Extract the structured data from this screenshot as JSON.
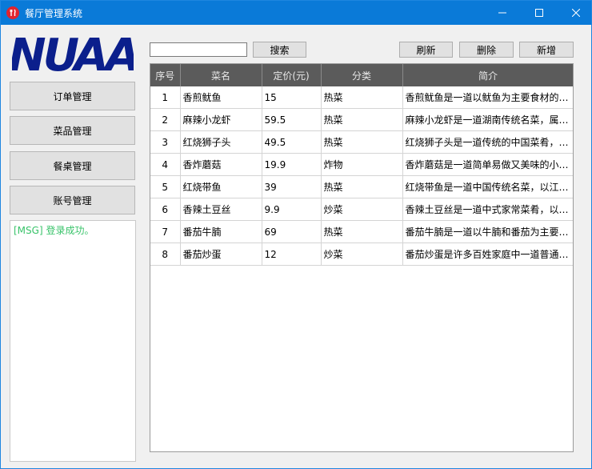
{
  "window": {
    "title": "餐厅管理系统",
    "accent": "#0a7ad8"
  },
  "logo": {
    "text": "NUAA",
    "color": "#0b1f8c"
  },
  "nav": [
    {
      "label": "订单管理"
    },
    {
      "label": "菜品管理"
    },
    {
      "label": "餐桌管理"
    },
    {
      "label": "账号管理"
    }
  ],
  "message": "[MSG] 登录成功。",
  "toolbar": {
    "search_value": "",
    "search_label": "搜索",
    "refresh_label": "刷新",
    "delete_label": "删除",
    "add_label": "新增"
  },
  "table": {
    "columns": [
      "序号",
      "菜名",
      "定价(元)",
      "分类",
      "简介"
    ],
    "rows": [
      [
        "1",
        "香煎鱿鱼",
        "15",
        "热菜",
        "香煎鱿鱼是一道以鱿鱼为主要食材的…"
      ],
      [
        "2",
        "麻辣小龙虾",
        "59.5",
        "热菜",
        "麻辣小龙虾是一道湖南传统名菜，属…"
      ],
      [
        "3",
        "红烧狮子头",
        "49.5",
        "热菜",
        "红烧狮子头是一道传统的中国菜肴，…"
      ],
      [
        "4",
        "香炸蘑菇",
        "19.9",
        "炸物",
        "香炸蘑菇是一道简单易做又美味的小…"
      ],
      [
        "5",
        "红烧带鱼",
        "39",
        "热菜",
        "红烧带鱼是一道中国传统名菜，以江…"
      ],
      [
        "6",
        "香辣土豆丝",
        "9.9",
        "炒菜",
        "香辣土豆丝是一道中式家常菜肴，以…"
      ],
      [
        "7",
        "番茄牛腩",
        "69",
        "热菜",
        "番茄牛腩是一道以牛腩和番茄为主要…"
      ],
      [
        "8",
        "番茄炒蛋",
        "12",
        "炒菜",
        "番茄炒蛋是许多百姓家庭中一道普通…"
      ]
    ]
  }
}
